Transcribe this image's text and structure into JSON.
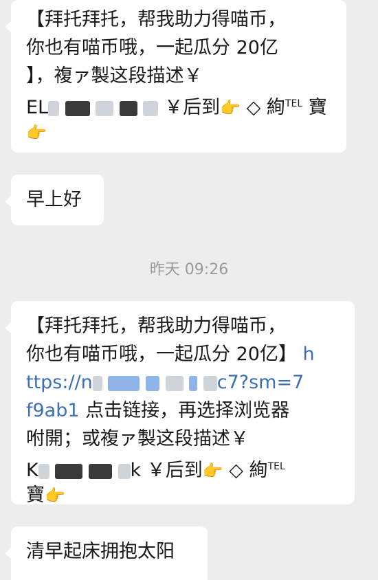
{
  "messages": [
    {
      "lines": [
        "【拜托拜托，帮我助力得喵币，",
        "你也有喵币哦，一起瓜分 20亿",
        "】，複ァ製这段描述￥"
      ],
      "line4_prefix": "EL",
      "line4_suffix": "￥后到",
      "emoji": "👉",
      "diamond": "◇",
      "word1": "絢",
      "tel": "TEL",
      "word2": "寶"
    },
    {
      "text": "早上好"
    },
    {
      "lines": [
        "【拜托拜托，帮我助力得喵币，"
      ],
      "line2_text": "你也有喵币哦，一起瓜分 20亿】",
      "link_h": "h",
      "link_prefix": "ttps://n",
      "link_suffix": "c7?sm=7",
      "link_tail": "f9ab1",
      "line4_text": " 点击链接，再选择浏览器",
      "line5_text": "咐開；或複ァ製这段描述￥",
      "line6_prefix": "K",
      "line6_mid": "k",
      "line6_suffix": "￥后到",
      "emoji": "👉",
      "diamond": "◇",
      "word1": "絢",
      "tel": "TEL",
      "word2": "寶"
    },
    {
      "text": "清早起床拥抱太阳"
    }
  ],
  "timestamp": "昨天 09:26"
}
